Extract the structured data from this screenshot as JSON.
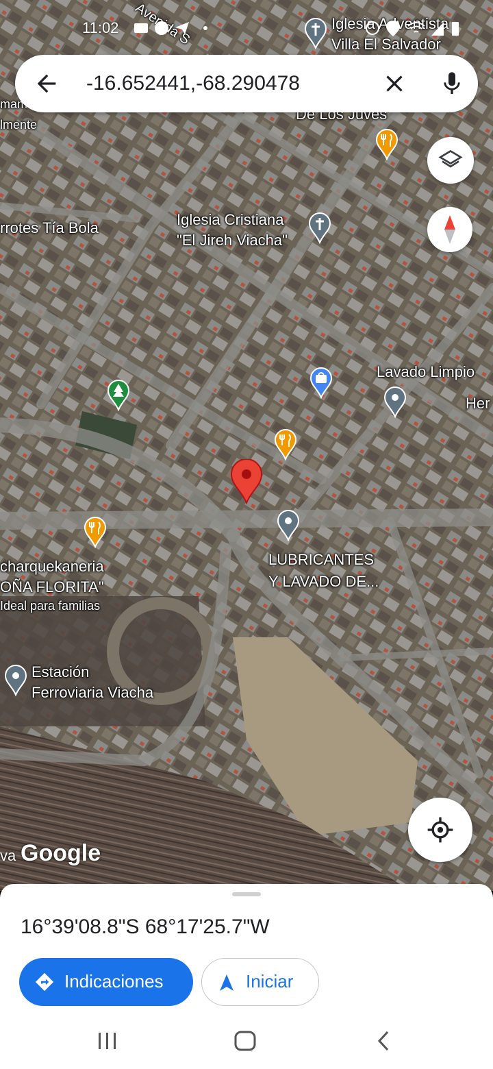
{
  "status_bar": {
    "time": "11:02",
    "icons": [
      "message-icon",
      "messenger-icon",
      "telegram-icon",
      "dot-icon"
    ],
    "right_icons": [
      "alarm-icon",
      "location-icon",
      "wifi-icon",
      "signal-icon",
      "battery-icon"
    ]
  },
  "search": {
    "query": "-16.652441,-68.290478",
    "icons": [
      "back-arrow-icon",
      "close-icon",
      "microphone-icon"
    ]
  },
  "map": {
    "labels": {
      "iglesia_adventista_1": "Iglesia Adventista",
      "iglesia_adventista_2": "Villa El Salvador",
      "avenida": "Avenida S",
      "de_los_juves": "De Los Juves",
      "mam": "mam",
      "lmente": "lmente",
      "tia_bola": "rrotes Tía Bola",
      "iglesia_cristiana_1": "Iglesia Cristiana",
      "iglesia_cristiana_2": "\"El Jireh Viacha\"",
      "lavado_limpio": "Lavado Limpio",
      "her": "Her",
      "lubricantes_1": "LUBRICANTES",
      "lubricantes_2": "Y LAVADO DE...",
      "charquekaneria_1": "charquekaneria",
      "charquekaneria_2": "OÑA FLORITA\"",
      "charquekaneria_3": "Ideal para familias",
      "estacion_1": "Estación",
      "estacion_2": "Ferroviaria Viacha",
      "va": "va"
    },
    "attribution": "Google",
    "accent_red": "#ea4335",
    "accent_orange": "#f29900",
    "accent_green": "#1e8e3e",
    "accent_blue": "#4285f4",
    "accent_gray": "#5f7480"
  },
  "controls": {
    "layers": "layers-icon",
    "compass": "compass-icon",
    "my_location": "my-location-icon"
  },
  "sheet": {
    "coordinates": "16°39'08.8\"S 68°17'25.7\"W",
    "directions_label": "Indicaciones",
    "start_label": "Iniciar",
    "primary_color": "#1a73e8"
  },
  "nav": {
    "recents": "recents-icon",
    "home": "home-icon",
    "back": "back-icon"
  }
}
